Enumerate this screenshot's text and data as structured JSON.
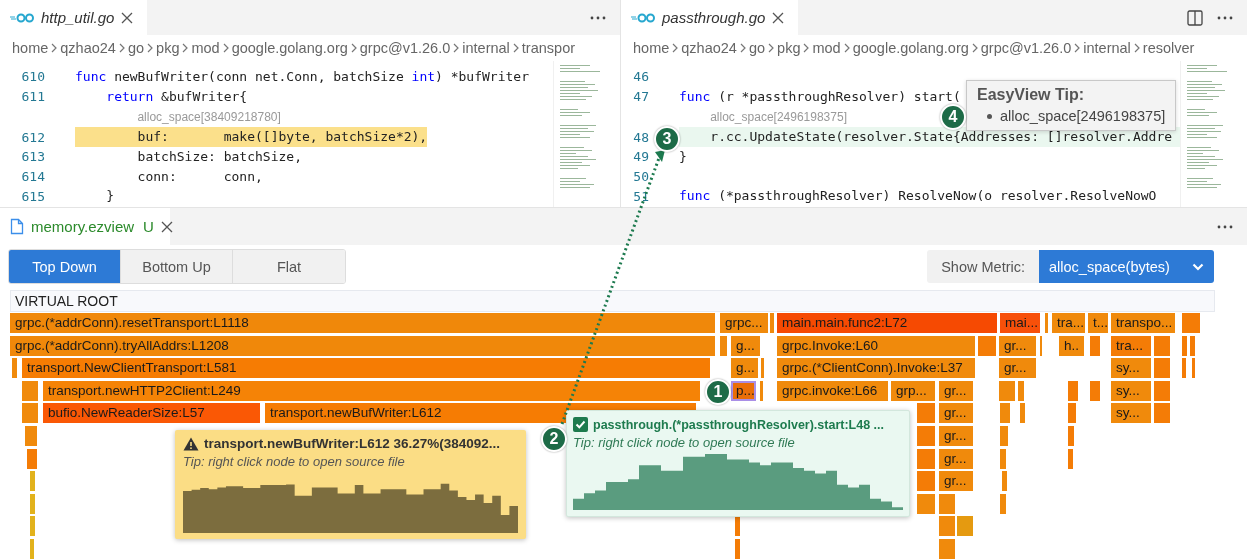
{
  "editors": [
    {
      "tab": {
        "title": "http_util.go"
      },
      "breadcrumb": [
        "home",
        "qzhao24",
        "go",
        "pkg",
        "mod",
        "google.golang.org",
        "grpc@v1.26.0",
        "internal",
        "transpor"
      ],
      "split_button": false,
      "lines": [
        {
          "kind": "code",
          "number": "610",
          "tokens": [
            {
              "text": "func",
              "kind": "keyword"
            },
            {
              "text": " newBufWriter(conn net.Conn, batchSize ",
              "kind": "plain"
            },
            {
              "text": "int",
              "kind": "keyword"
            },
            {
              "text": ") *bufWriter",
              "kind": "plain"
            }
          ]
        },
        {
          "kind": "code",
          "number": "611",
          "tokens": [
            {
              "text": "    return",
              "kind": "keyword"
            },
            {
              "text": " &bufWriter{",
              "kind": "plain"
            }
          ]
        },
        {
          "kind": "lens",
          "text": "alloc_space[38409218780]"
        },
        {
          "kind": "hot",
          "number": "612",
          "tokens": [
            {
              "text": "        buf:       make([]byte, batchSize*2),",
              "kind": "plain"
            }
          ]
        },
        {
          "kind": "code",
          "number": "613",
          "tokens": [
            {
              "text": "        batchSize: batchSize,",
              "kind": "plain"
            }
          ]
        },
        {
          "kind": "code",
          "number": "614",
          "tokens": [
            {
              "text": "        conn:      conn,",
              "kind": "plain"
            }
          ]
        },
        {
          "kind": "code",
          "number": "615",
          "tokens": [
            {
              "text": "    }",
              "kind": "plain"
            }
          ]
        }
      ]
    },
    {
      "tab": {
        "title": "passthrough.go"
      },
      "breadcrumb": [
        "home",
        "qzhao24",
        "go",
        "pkg",
        "mod",
        "google.golang.org",
        "grpc@v1.26.0",
        "internal",
        "resolver"
      ],
      "split_button": true,
      "lines": [
        {
          "kind": "code",
          "number": "46"
        },
        {
          "kind": "code",
          "number": "47",
          "tokens": [
            {
              "text": "func",
              "kind": "keyword"
            },
            {
              "text": " (r *passthroughResolver) start(",
              "kind": "plain"
            }
          ]
        },
        {
          "kind": "lens",
          "text": "alloc_space[2496198375]"
        },
        {
          "kind": "match",
          "number": "48",
          "tokens": [
            {
              "text": "    r.cc.UpdateState(resolver.State{Addresses: []resolver.Addre",
              "kind": "plain"
            }
          ]
        },
        {
          "kind": "code",
          "number": "49",
          "tokens": [
            {
              "text": "}",
              "kind": "plain"
            }
          ]
        },
        {
          "kind": "code",
          "number": "50"
        },
        {
          "kind": "code",
          "number": "51",
          "tokens": [
            {
              "text": "func",
              "kind": "keyword"
            },
            {
              "text": " (*passthroughResolver) ResolveNow(o resolver.ResolveNowO",
              "kind": "plain"
            }
          ]
        }
      ],
      "hover": {
        "title": "EasyView Tip:",
        "items": [
          "alloc_space[2496198375]"
        ]
      }
    }
  ],
  "panel": {
    "tab": {
      "title": "memory.ezview",
      "badge": "U"
    },
    "views": [
      {
        "label": "Top Down",
        "selected": true
      },
      {
        "label": "Bottom Up",
        "selected": false
      },
      {
        "label": "Flat",
        "selected": false
      }
    ],
    "metric": {
      "label": "Show Metric:",
      "value": "alloc_space(bytes)"
    },
    "flame_graph": {
      "root": "VIRTUAL ROOT",
      "rows": [
        {
          "frames": [
            {
              "label": "grpc.(*addrConn).resetTransport:L1118",
              "color": "#f0880a",
              "selected": false
            },
            {
              "label": "grpc...",
              "color": "#f08a0c",
              "selected": false
            },
            {
              "label": "main.main.func2:L72",
              "color": "#f64a02",
              "selected": false
            },
            {
              "label": "mai...",
              "color": "#f7500a",
              "selected": false
            },
            {
              "label": "tra...",
              "color": "#f08a0c",
              "selected": false
            },
            {
              "label": "t...",
              "color": "#f08a0c",
              "selected": false
            },
            {
              "label": "transpo...",
              "color": "#f08a0c",
              "selected": false
            }
          ]
        },
        {
          "frames": [
            {
              "label": "grpc.(*addrConn).tryAllAddrs:L1208",
              "color": "#f0880a",
              "selected": false
            },
            {
              "label": "g...",
              "color": "#f08a0c",
              "selected": false
            },
            {
              "label": "grpc.Invoke:L60",
              "color": "#f08a0c",
              "selected": false
            },
            {
              "label": "gr...",
              "color": "#f08a0c",
              "selected": false
            },
            {
              "label": "h..",
              "color": "#f08a0c",
              "selected": false
            },
            {
              "label": "tra...",
              "color": "#f47c06",
              "selected": false
            }
          ]
        },
        {
          "frames": [
            {
              "label": "transport.NewClientTransport:L581",
              "color": "#f67c03",
              "selected": false
            },
            {
              "label": "g...",
              "color": "#f08a0c",
              "selected": false
            },
            {
              "label": "grpc.(*ClientConn).Invoke:L37",
              "color": "#f08a0c",
              "selected": false
            },
            {
              "label": "gr...",
              "color": "#f08a0c",
              "selected": false
            },
            {
              "label": "sy...",
              "color": "#f08a0c",
              "selected": false
            }
          ]
        },
        {
          "frames": [
            {
              "label": "transport.newHTTP2Client:L249",
              "color": "#f58306",
              "selected": false
            },
            {
              "label": "p...",
              "color": "#ea6e08",
              "selected": true
            },
            {
              "label": "grpc.invoke:L66",
              "color": "#f08a0c",
              "selected": false
            },
            {
              "label": "grp...",
              "color": "#f08a0c",
              "selected": false
            },
            {
              "label": "gr...",
              "color": "#f08a0c",
              "selected": false
            },
            {
              "label": "sy...",
              "color": "#f08a0c",
              "selected": false
            }
          ]
        },
        {
          "frames": [
            {
              "label": "bufio.NewReaderSize:L57",
              "color": "#fa5805",
              "selected": false
            },
            {
              "label": "transport.newBufWriter:L612",
              "color": "#f67c03",
              "selected": false
            },
            {
              "label": "gr...",
              "color": "#f08a0c",
              "selected": false
            },
            {
              "label": "sy...",
              "color": "#f08a0c",
              "selected": false
            }
          ]
        },
        {
          "frames": [
            {
              "label": "gr...",
              "color": "#f08a0c",
              "selected": false
            }
          ]
        },
        {
          "frames": [
            {
              "label": "gr...",
              "color": "#f08a0c",
              "selected": false
            }
          ]
        },
        {
          "frames": [
            {
              "label": "gr...",
              "color": "#f08a0c",
              "selected": false
            }
          ]
        }
      ]
    },
    "tooltips": [
      {
        "kind": "warning",
        "title": "transport.newBufWriter:L612 36.27%(384092...",
        "tip": "Tip: right click node to open source file"
      },
      {
        "kind": "ok",
        "title": "passthrough.(*passthroughResolver).start:L48 ...",
        "tip": "Tip: right click node to open source file"
      }
    ]
  },
  "annotations": [
    {
      "number": "1"
    },
    {
      "number": "2"
    },
    {
      "number": "3"
    },
    {
      "number": "4"
    }
  ]
}
